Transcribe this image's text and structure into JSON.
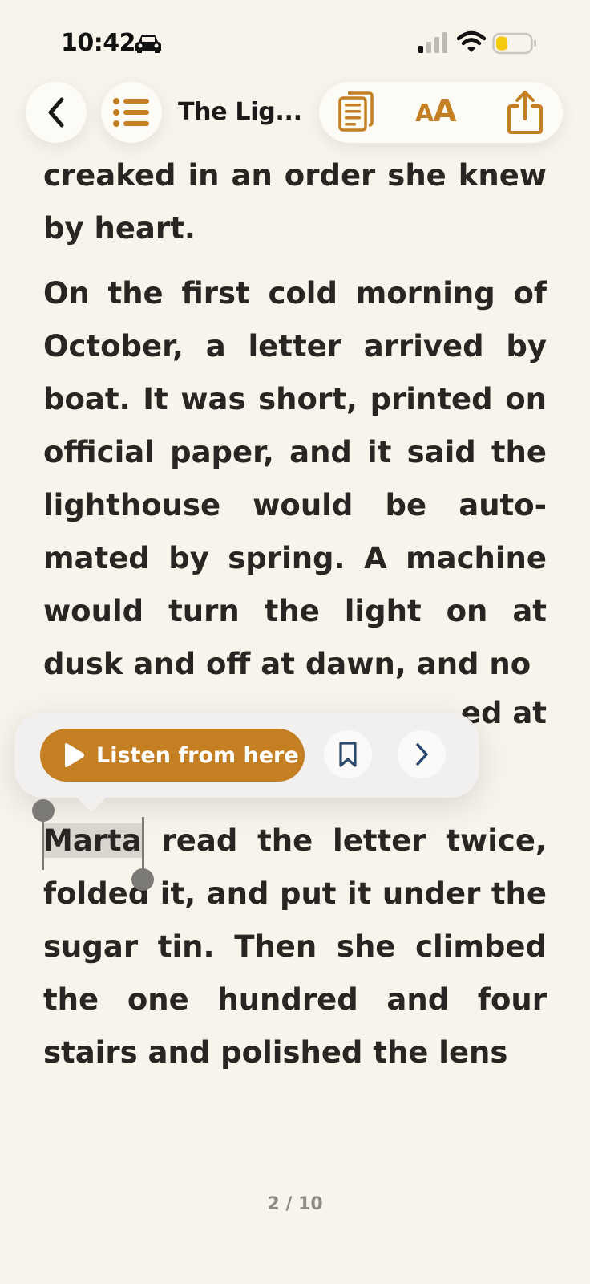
{
  "status_bar": {
    "time": "10:42",
    "icons": [
      "car-icon",
      "signal-icon",
      "wifi-icon",
      "battery-icon"
    ],
    "battery_color": "#f4c90f"
  },
  "toolbar": {
    "book_title": "The Lig...",
    "aa_label_large": "A",
    "aa_label_small": "A",
    "icons": [
      "back-icon",
      "list-icon",
      "pages-icon",
      "share-icon"
    ],
    "accent_color": "#c47f23"
  },
  "content": {
    "paragraph_1": "creaked in an order she knew by heart.",
    "paragraph_2": "On the first cold morning of October, a letter arrived by boat. It was short, printed on official paper, and it said the lighthouse would be auto-mated by spring. A machine would turn the light on at dusk and off at dawn, and no",
    "paragraph_2_partial": "ed at",
    "paragraph_3_selected": "Marta",
    "paragraph_3_rest": " read the letter twice, folded it, and put it under the sugar tin. Then she climbed the one hundred and four stairs and polished the lens"
  },
  "popup": {
    "listen_label": "Listen from here",
    "icons": [
      "play-icon",
      "bookmark-icon",
      "chevron-right-icon"
    ]
  },
  "footer": {
    "page_indicator": "2 / 10"
  }
}
